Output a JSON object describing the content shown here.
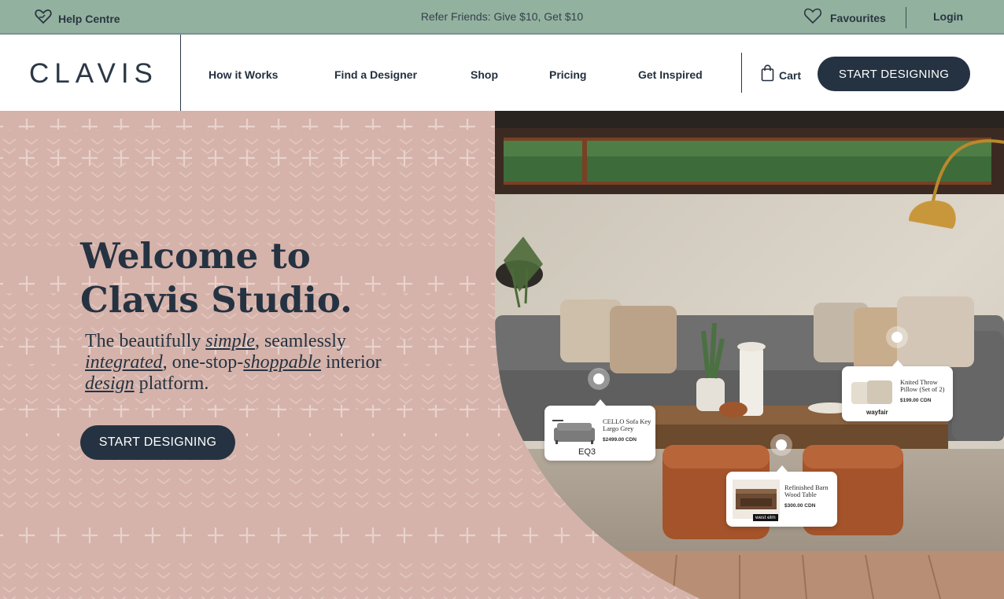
{
  "topbar": {
    "help_label": "Help Centre",
    "promo": "Refer Friends: Give $10, Get $10",
    "favourites_label": "Favourites",
    "login_label": "Login"
  },
  "nav": {
    "logo": "CLAVIS",
    "links": [
      "How it Works",
      "Find a Designer",
      "Shop",
      "Pricing",
      "Get Inspired"
    ],
    "cart_label": "Cart",
    "cta_label": "START DESIGNING"
  },
  "hero": {
    "headline_line1": "Welcome to",
    "headline_line2": "Clavis Studio.",
    "sub": {
      "t1": "The beautifully ",
      "e1": "simple",
      "t2": ", seamlessly ",
      "e2": "integrated",
      "t3": ", one-stop-",
      "e3": "shoppable",
      "t4": " interior ",
      "e4": "design",
      "t5": " platform."
    },
    "cta_label": "START DESIGNING"
  },
  "products": [
    {
      "name": "CELLO Sofa Key Largo Grey",
      "price": "$2499.00 CDN",
      "brand": "EQ3"
    },
    {
      "name": "Refinished Barn Wood Table",
      "price": "$300.00 CDN",
      "brand": "west elm"
    },
    {
      "name": "Knited Throw Pillow (Set of 2)",
      "price": "$199.00 CDN",
      "brand": "wayfair"
    }
  ],
  "colors": {
    "topbar_bg": "#93b19f",
    "navy": "#253241",
    "hero_pink": "#d5b3aa"
  },
  "icons": {
    "help": "heart-hand-icon",
    "favourites": "heart-icon",
    "cart": "shopping-bag-icon"
  }
}
